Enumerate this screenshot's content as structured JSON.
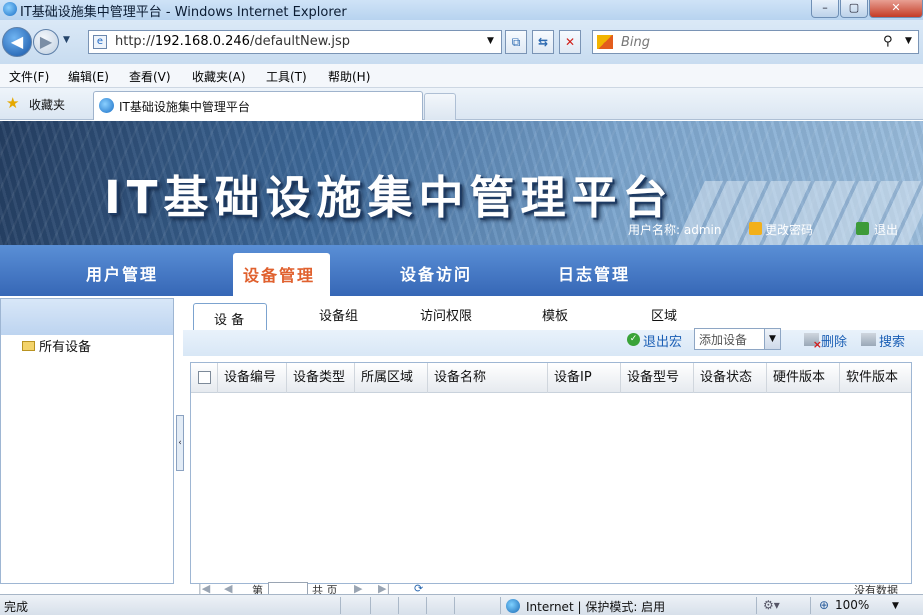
{
  "window": {
    "title": "IT基础设施集中管理平台 - Windows Internet Explorer",
    "min": "–",
    "max": "▢",
    "close": "✕"
  },
  "address": {
    "url_prefix": "http://",
    "url_host": "192.168.0.246",
    "url_path": "/defaultNew.jsp",
    "search_placeholder": "Bing"
  },
  "menu": [
    "文件(F)",
    "编辑(E)",
    "查看(V)",
    "收藏夹(A)",
    "工具(T)",
    "帮助(H)"
  ],
  "favorites": {
    "label": "收藏夹",
    "tab_title": "IT基础设施集中管理平台"
  },
  "banner": {
    "title": "IT基础设施集中管理平台",
    "user_label": "用户名称: admin",
    "change_password": "更改密码",
    "logout": "退出"
  },
  "nav": {
    "items": [
      "用户管理",
      "设备管理",
      "设备访问",
      "日志管理"
    ],
    "active_index": 1
  },
  "tree": {
    "root": "所有设备"
  },
  "subtabs": [
    "设 备",
    "设备组",
    "访问权限",
    "模板",
    "区域"
  ],
  "toolbar": {
    "exit_macro": "退出宏",
    "add_device": "添加设备",
    "delete": "删除",
    "search": "搜索"
  },
  "grid": {
    "columns": [
      "设备编号",
      "设备类型",
      "所属区域",
      "设备名称",
      "设备IP",
      "设备型号",
      "设备状态",
      "硬件版本",
      "软件版本"
    ]
  },
  "pager": {
    "page_label": "第",
    "of_label": "共 页",
    "no_data": "没有数据"
  },
  "status": {
    "text": "完成",
    "zone": "Internet | 保护模式: 启用",
    "zoom": "100%"
  },
  "colors": {
    "nav_bg": "#3f72c0",
    "nav_active_text": "#e0612f",
    "link_blue": "#1b5fb5"
  }
}
